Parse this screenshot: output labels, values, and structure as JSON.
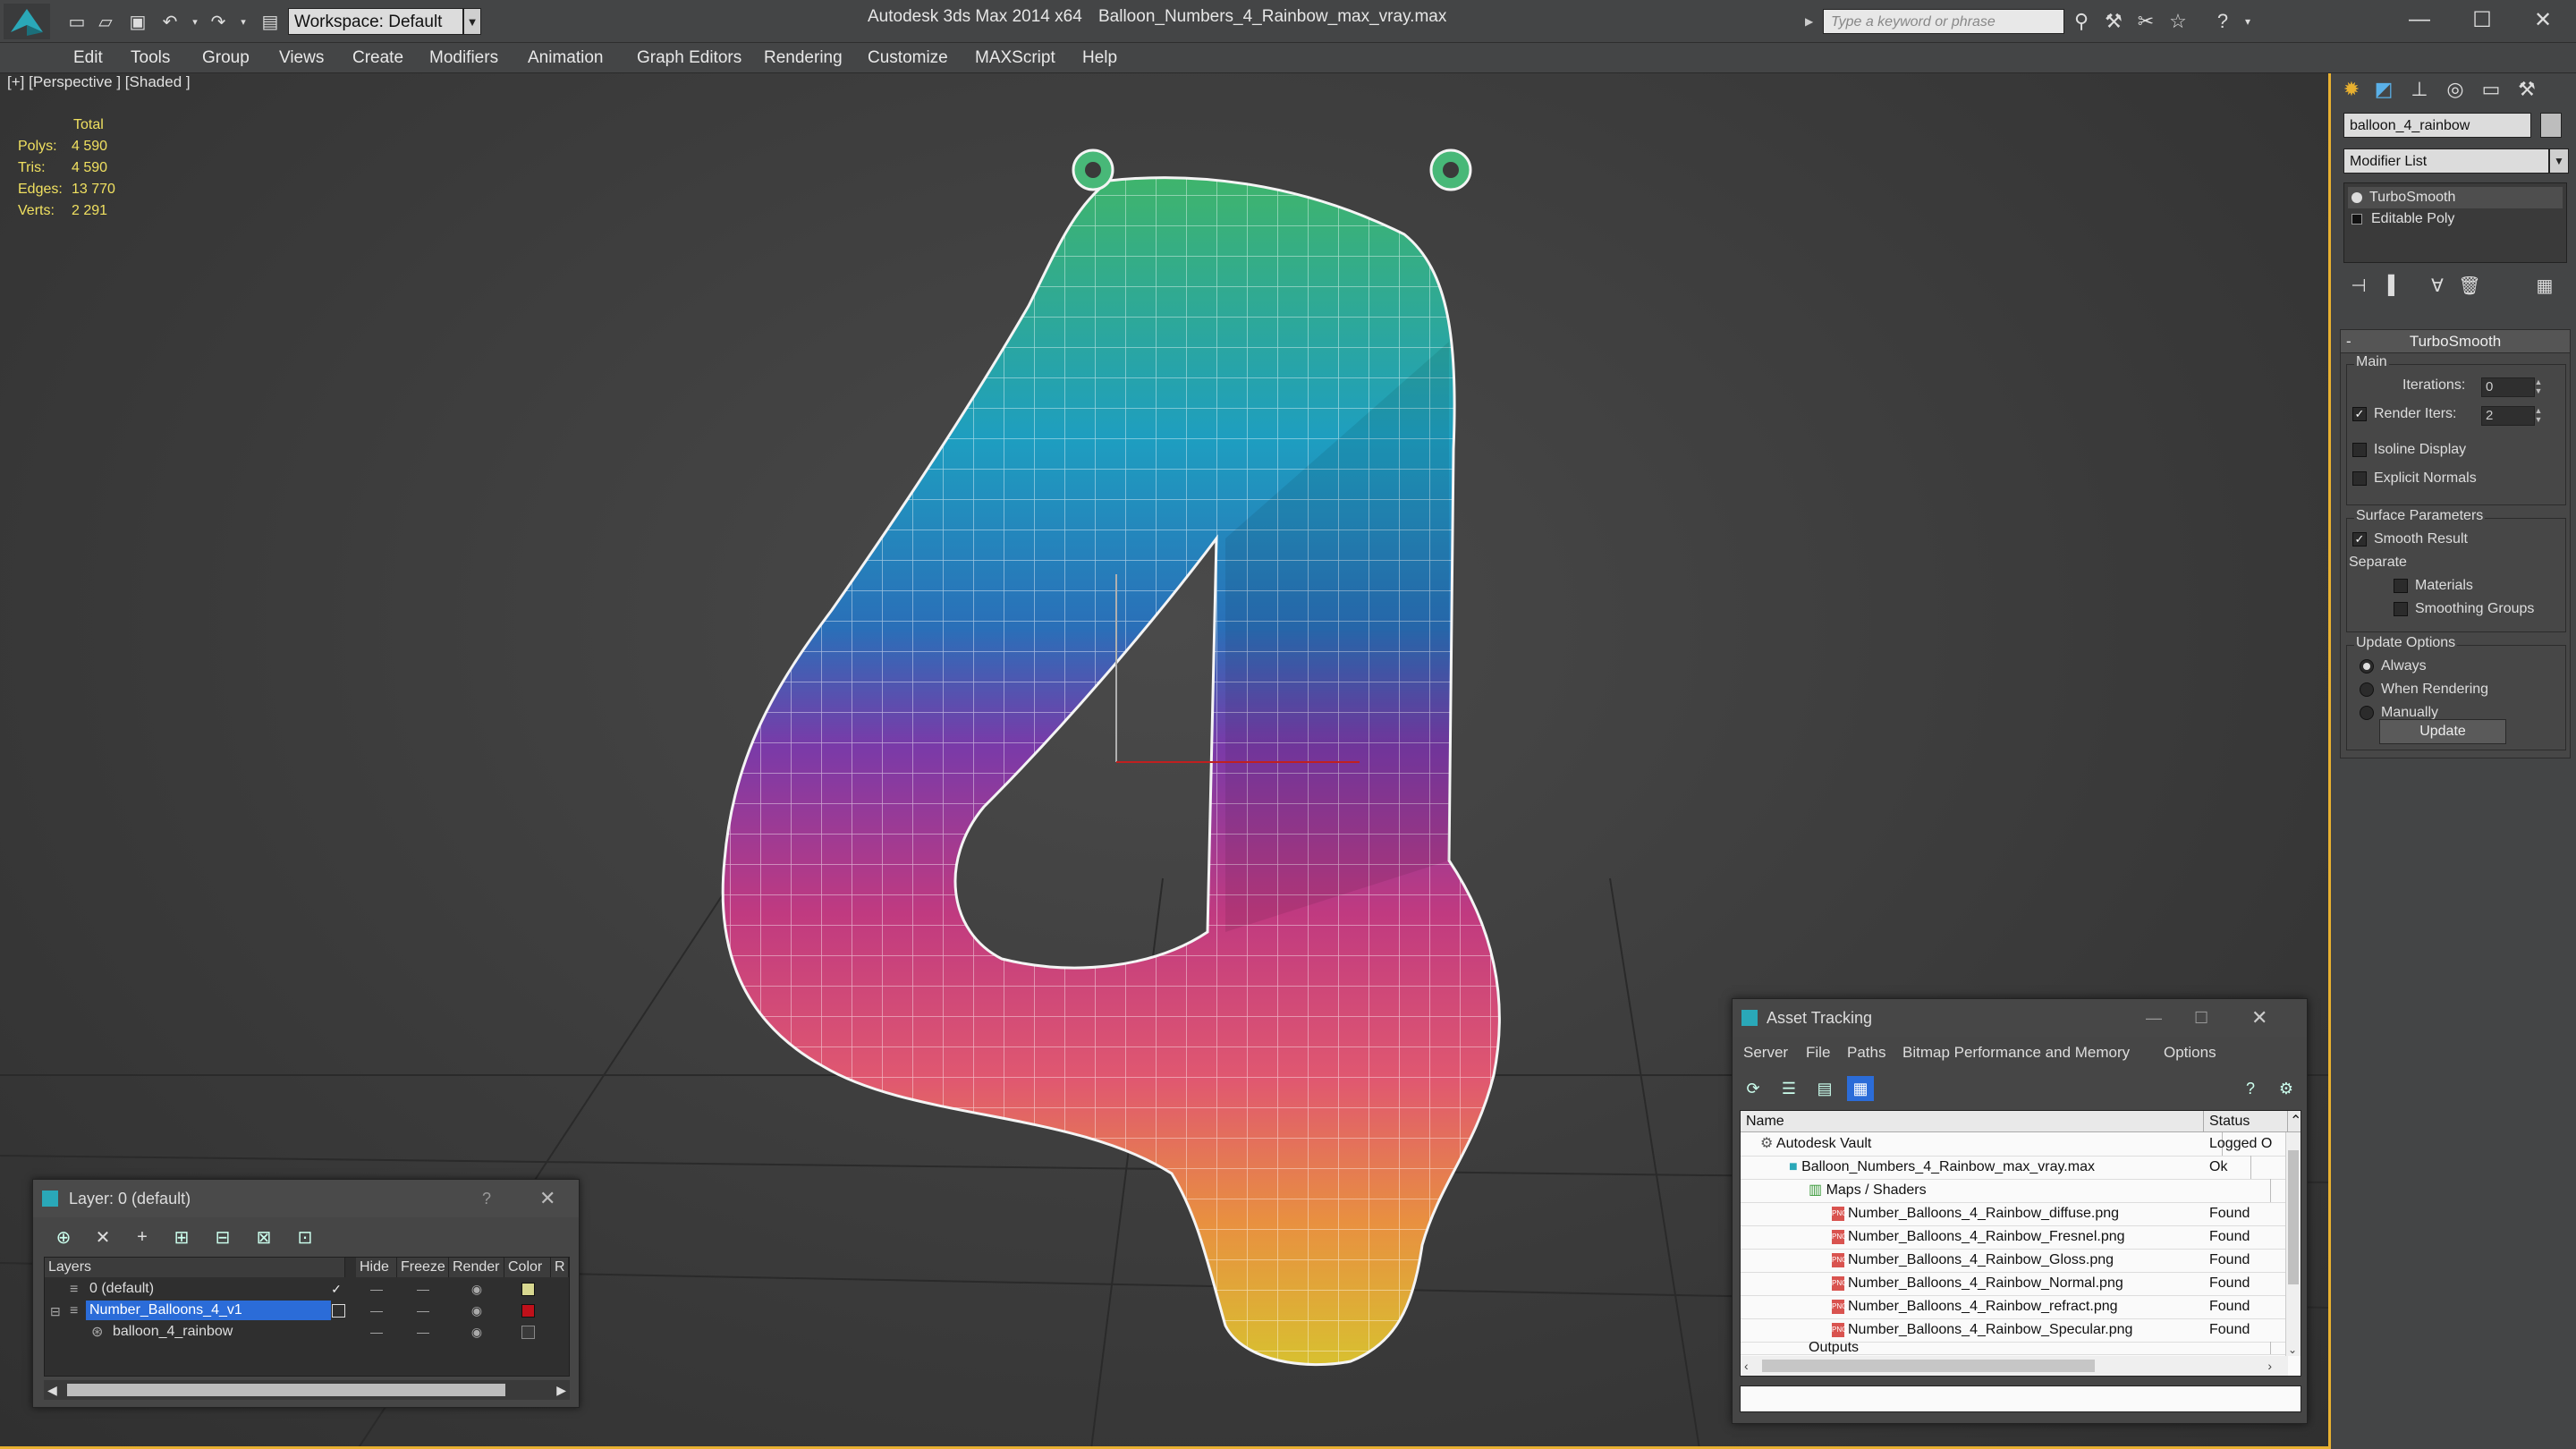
{
  "titlebar": {
    "app_title": "Autodesk 3ds Max  2014 x64",
    "file_title": "Balloon_Numbers_4_Rainbow_max_vray.max",
    "workspace": "Workspace: Default",
    "search_placeholder": "Type a keyword or phrase"
  },
  "menu": [
    "Edit",
    "Tools",
    "Group",
    "Views",
    "Create",
    "Modifiers",
    "Animation",
    "Graph Editors",
    "Rendering",
    "Customize",
    "MAXScript",
    "Help"
  ],
  "viewport": {
    "label": "[+] [Perspective ] [Shaded ]",
    "stats_header": "Total",
    "stats": [
      {
        "k": "Polys:",
        "v": "4 590"
      },
      {
        "k": "Tris:",
        "v": "4 590"
      },
      {
        "k": "Edges:",
        "v": "13 770"
      },
      {
        "k": "Verts:",
        "v": "2 291"
      }
    ]
  },
  "command_panel": {
    "object_name": "balloon_4_rainbow",
    "modifier_list": "Modifier List",
    "stack": [
      "TurboSmooth",
      "Editable Poly"
    ],
    "rollout_title": "TurboSmooth",
    "main_group": "Main",
    "iterations_label": "Iterations:",
    "iterations_value": "0",
    "render_iters_label": "Render Iters:",
    "render_iters_value": "2",
    "isoline_label": "Isoline Display",
    "explicit_label": "Explicit Normals",
    "surface_group": "Surface Parameters",
    "smooth_label": "Smooth Result",
    "separate_label": "Separate",
    "materials_label": "Materials",
    "smoothing_groups_label": "Smoothing Groups",
    "update_group": "Update Options",
    "always_label": "Always",
    "when_rendering_label": "When Rendering",
    "manually_label": "Manually",
    "update_button": "Update"
  },
  "layer_window": {
    "title": "Layer: 0 (default)",
    "help": "?",
    "columns": [
      "Layers",
      "Hide",
      "Freeze",
      "Render",
      "Color",
      "R"
    ],
    "rows": [
      {
        "name": "0 (default)",
        "color": "#d8d890"
      },
      {
        "name": "Number_Balloons_4_v1",
        "color": "#c0101a"
      },
      {
        "name": "balloon_4_rainbow",
        "color": "#3a3a3a"
      }
    ]
  },
  "asset_window": {
    "title": "Asset Tracking",
    "menu": [
      "Server",
      "File",
      "Paths",
      "Bitmap Performance and Memory",
      "Options"
    ],
    "columns": [
      "Name",
      "Status"
    ],
    "rows": [
      {
        "name": "Autodesk Vault",
        "status": "Logged O"
      },
      {
        "name": "Balloon_Numbers_4_Rainbow_max_vray.max",
        "status": "Ok"
      },
      {
        "name": "Maps / Shaders",
        "status": ""
      },
      {
        "name": "Number_Balloons_4_Rainbow_diffuse.png",
        "status": "Found"
      },
      {
        "name": "Number_Balloons_4_Rainbow_Fresnel.png",
        "status": "Found"
      },
      {
        "name": "Number_Balloons_4_Rainbow_Gloss.png",
        "status": "Found"
      },
      {
        "name": "Number_Balloons_4_Rainbow_Normal.png",
        "status": "Found"
      },
      {
        "name": "Number_Balloons_4_Rainbow_refract.png",
        "status": "Found"
      },
      {
        "name": "Number_Balloons_4_Rainbow_Specular.png",
        "status": "Found"
      },
      {
        "name": "Outputs",
        "status": ""
      }
    ]
  },
  "colors": {
    "viewport_border": "#e8b030",
    "stats_text": "#f0e060",
    "selection": "#2b6cd8"
  }
}
